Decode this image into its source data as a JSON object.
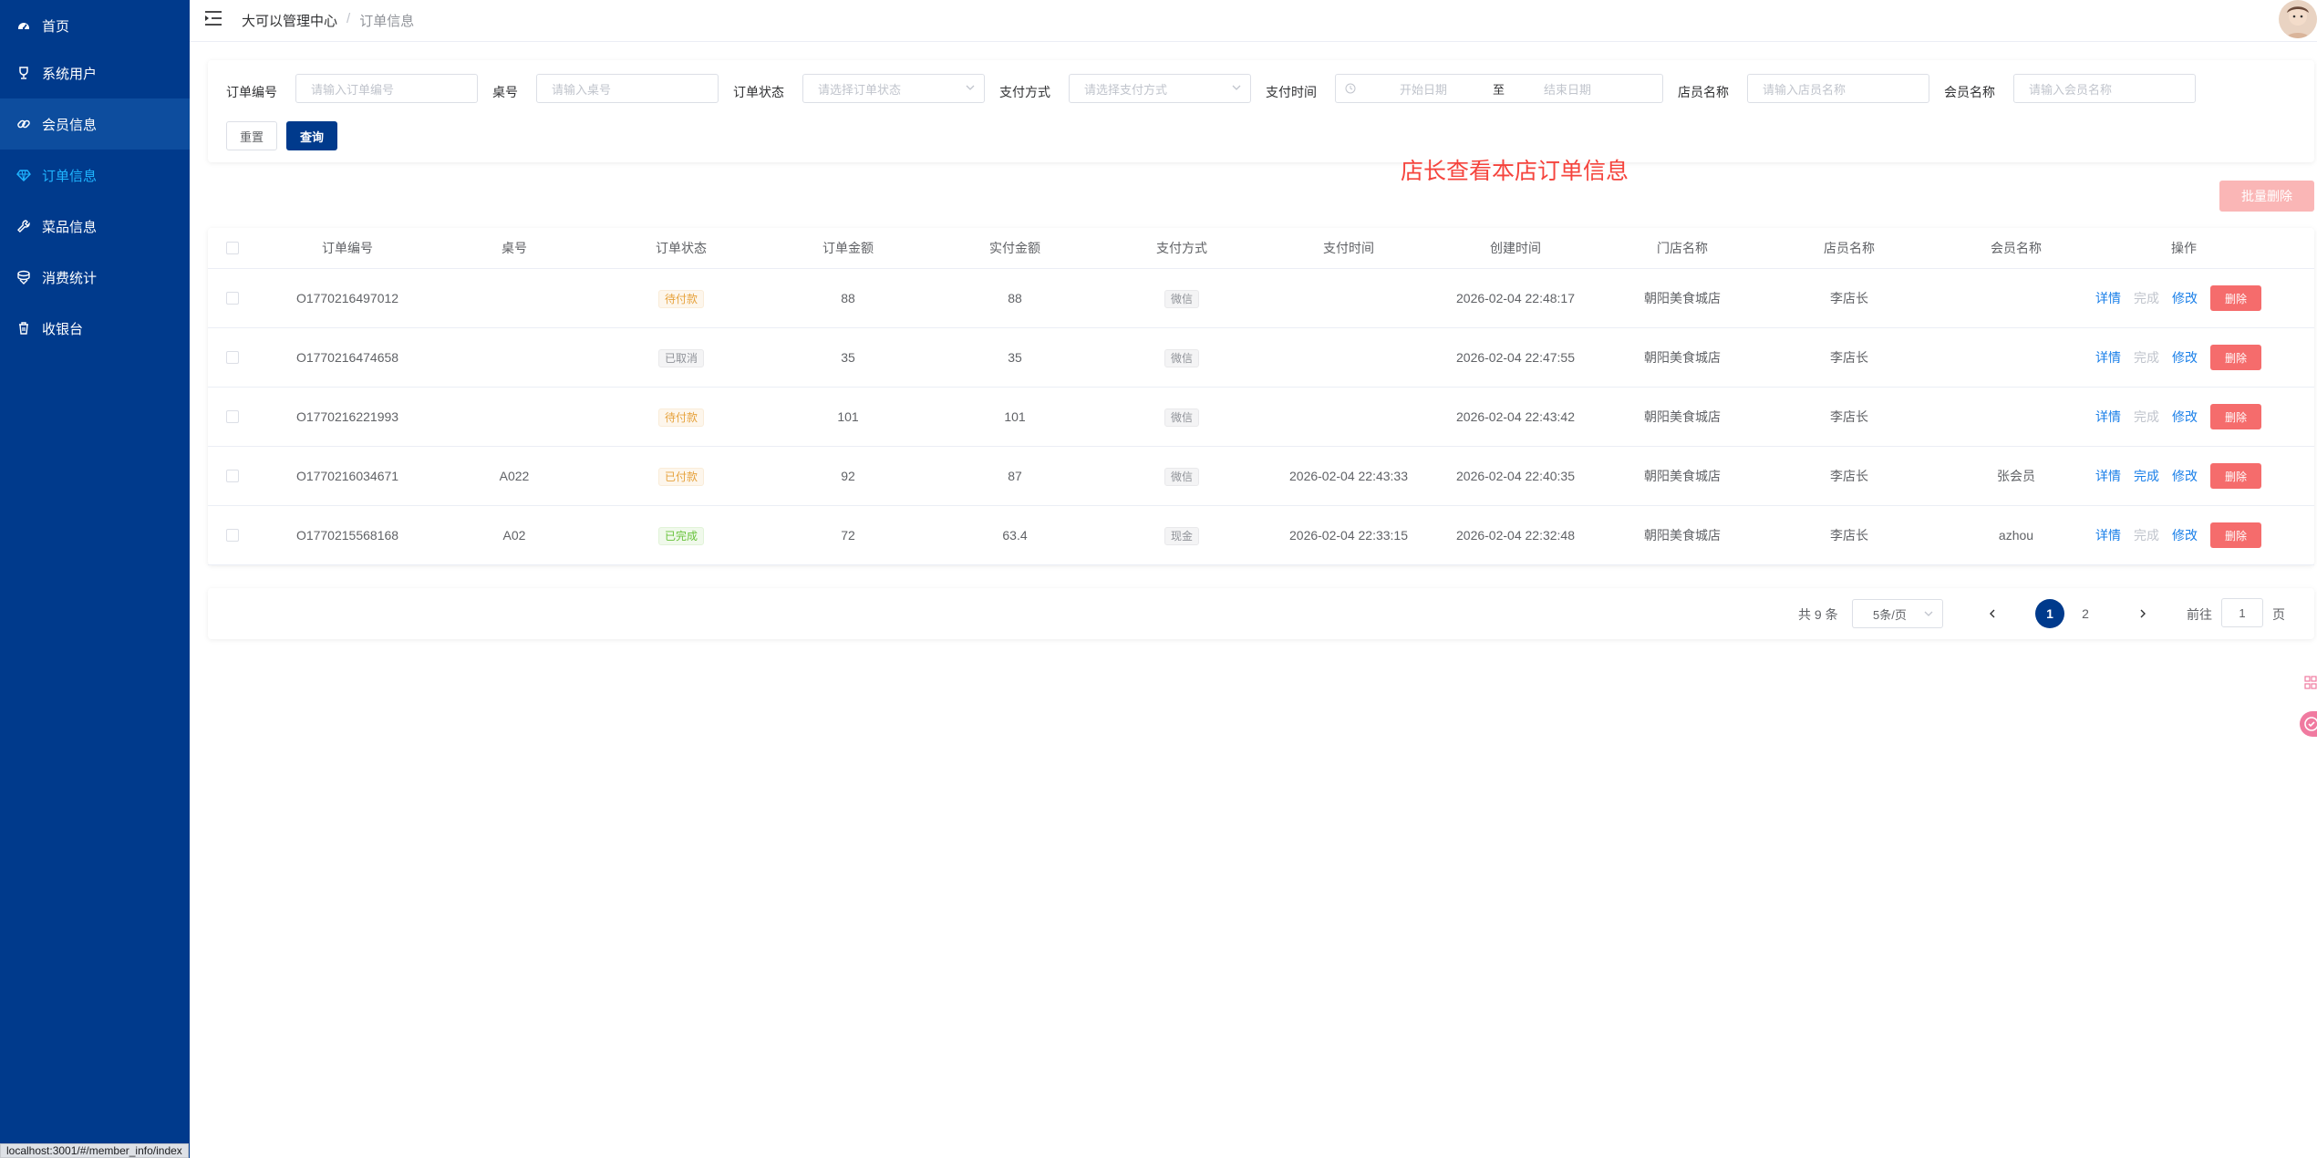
{
  "sidebar": {
    "items": [
      {
        "label": "首页",
        "icon": "dashboard-icon"
      },
      {
        "label": "系统用户",
        "icon": "trophy-icon"
      },
      {
        "label": "会员信息",
        "icon": "link-icon"
      },
      {
        "label": "订单信息",
        "icon": "gem-icon"
      },
      {
        "label": "菜品信息",
        "icon": "wrench-icon"
      },
      {
        "label": "消费统计",
        "icon": "coin-stack-icon"
      },
      {
        "label": "收银台",
        "icon": "trash-icon"
      }
    ],
    "active_index": 3
  },
  "header": {
    "breadcrumb_root": "大可以管理中心",
    "breadcrumb_sep": "/",
    "breadcrumb_current": "订单信息"
  },
  "search": {
    "order_no_label": "订单编号",
    "order_no_placeholder": "请输入订单编号",
    "table_no_label": "桌号",
    "table_no_placeholder": "请输入桌号",
    "status_label": "订单状态",
    "status_placeholder": "请选择订单状态",
    "pay_method_label": "支付方式",
    "pay_method_placeholder": "请选择支付方式",
    "pay_time_label": "支付时间",
    "start_date_placeholder": "开始日期",
    "range_sep": "至",
    "end_date_placeholder": "结束日期",
    "clerk_label": "店员名称",
    "clerk_placeholder": "请输入店员名称",
    "member_label": "会员名称",
    "member_placeholder": "请输入会员名称",
    "reset_label": "重置",
    "query_label": "查询"
  },
  "notice": "店长查看本店订单信息",
  "batch_delete_label": "批量删除",
  "table": {
    "columns": [
      "订单编号",
      "桌号",
      "订单状态",
      "订单金额",
      "实付金额",
      "支付方式",
      "支付时间",
      "创建时间",
      "门店名称",
      "店员名称",
      "会员名称",
      "操作"
    ],
    "rows": [
      {
        "order_no": "O1770216497012",
        "table_no": "",
        "status": "待付款",
        "status_type": "warn",
        "amount": "88",
        "paid": "88",
        "pay_method": "微信",
        "pay_time": "",
        "created": "2026-02-04 22:48:17",
        "store": "朝阳美食城店",
        "clerk": "李店长",
        "member": "",
        "complete_enabled": false
      },
      {
        "order_no": "O1770216474658",
        "table_no": "",
        "status": "已取消",
        "status_type": "info",
        "amount": "35",
        "paid": "35",
        "pay_method": "微信",
        "pay_time": "",
        "created": "2026-02-04 22:47:55",
        "store": "朝阳美食城店",
        "clerk": "李店长",
        "member": "",
        "complete_enabled": false
      },
      {
        "order_no": "O1770216221993",
        "table_no": "",
        "status": "待付款",
        "status_type": "warn",
        "amount": "101",
        "paid": "101",
        "pay_method": "微信",
        "pay_time": "",
        "created": "2026-02-04 22:43:42",
        "store": "朝阳美食城店",
        "clerk": "李店长",
        "member": "",
        "complete_enabled": false
      },
      {
        "order_no": "O1770216034671",
        "table_no": "A022",
        "status": "已付款",
        "status_type": "warn",
        "amount": "92",
        "paid": "87",
        "pay_method": "微信",
        "pay_time": "2026-02-04 22:43:33",
        "created": "2026-02-04 22:40:35",
        "store": "朝阳美食城店",
        "clerk": "李店长",
        "member": "张会员",
        "complete_enabled": true
      },
      {
        "order_no": "O1770215568168",
        "table_no": "A02",
        "status": "已完成",
        "status_type": "ok",
        "amount": "72",
        "paid": "63.4",
        "pay_method": "现金",
        "pay_time": "2026-02-04 22:33:15",
        "created": "2026-02-04 22:32:48",
        "store": "朝阳美食城店",
        "clerk": "李店长",
        "member": "azhou",
        "complete_enabled": false
      }
    ],
    "ops": {
      "detail": "详情",
      "complete": "完成",
      "edit": "修改",
      "delete": "删除"
    }
  },
  "pagination": {
    "total": "共 9 条",
    "page_size": "5条/页",
    "pages": [
      "1",
      "2"
    ],
    "current": "1",
    "goto_label": "前往",
    "goto_value": "1",
    "page_suffix": "页"
  },
  "status_bar_url": "localhost:3001/#/member_info/index",
  "colors": {
    "sidebar_bg": "#003a8c",
    "sidebar_active_bg": "#0d4d9e",
    "sidebar_current_text": "#1fb4ff",
    "primary": "#003a8c",
    "danger": "#f56c6c",
    "notice_red": "#f5443d",
    "link_blue": "#1a7fe8"
  }
}
